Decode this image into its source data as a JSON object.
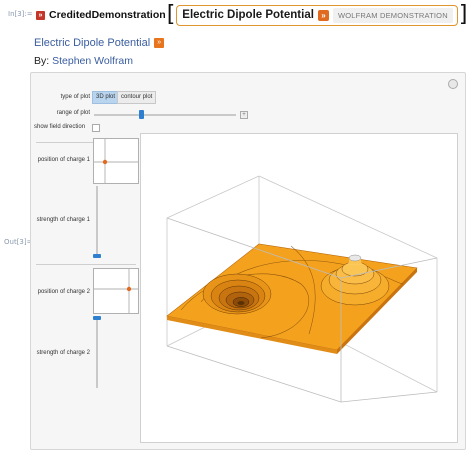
{
  "input_cell": {
    "label": "In[3]:=",
    "function": "CreditedDemonstration",
    "entity_name": "Electric Dipole Potential",
    "entity_type": "WOLFRAM DEMONSTRATION",
    "open_bracket": "[",
    "close_bracket": "]",
    "wolfram_icon": "»",
    "entity_arrow": "»"
  },
  "output_cell": {
    "label": "Out[3]=",
    "title": "Electric Dipole Potential",
    "title_icon": "»",
    "by_prefix": "By: ",
    "author": "Stephen Wolfram"
  },
  "controls": {
    "type_of_plot_label": "type of plot",
    "plot_options": [
      "3D plot",
      "contour plot"
    ],
    "selected_plot": "3D plot",
    "range_label": "range of plot",
    "range_value": 0.25,
    "show_field_label": "show field direction",
    "show_field_checked": false,
    "charge1_position_label": "position of charge 1",
    "charge1_strength_label": "strength of charge 1",
    "charge1_strength_value": 0.05,
    "charge2_position_label": "position of charge 2",
    "charge2_strength_label": "strength of charge 2",
    "charge2_strength_value": 1.0,
    "plus_icon": "+",
    "options_icon": "gear-icon"
  },
  "colors": {
    "surface": "#f4a21e",
    "surface_dark": "#c9740f",
    "slider_accent": "#2f7fd0",
    "marker": "#e06a1f"
  }
}
